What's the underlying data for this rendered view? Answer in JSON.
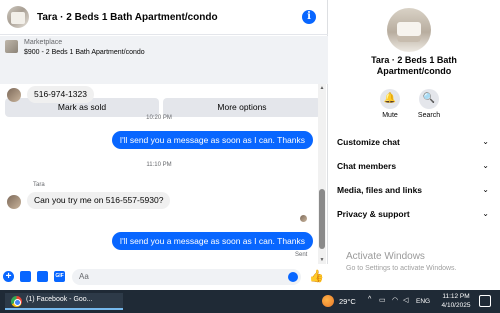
{
  "header": {
    "title": "Tara · 2 Beds 1 Bath Apartment/condo"
  },
  "listing": {
    "label": "Marketplace",
    "title": "$900 - 2 Beds 1 Bath Apartment/condo",
    "buttons": [
      "Mark as sold",
      "More options"
    ]
  },
  "messages": {
    "phone_bubble": "516-974-1323",
    "time_1": "10:20 PM",
    "out_1": "I'll send you a message as soon as I can. Thanks",
    "time_2": "11:10 PM",
    "sender": "Tara",
    "in_1": "Can you try me on 516-557-5930?",
    "out_2": "I'll send you a message as soon as I can. Thanks",
    "status": "Sent"
  },
  "composer": {
    "placeholder": "Aa"
  },
  "side": {
    "title": "Tara · 2 Beds 1 Bath Apartment/condo",
    "actions": [
      "Mute",
      "Search"
    ],
    "sections": [
      "Customize chat",
      "Chat members",
      "Media, files and links",
      "Privacy & support"
    ]
  },
  "watermark": {
    "title": "Activate Windows",
    "sub": "Go to Settings to activate Windows."
  },
  "taskbar": {
    "app_label": "(1) Facebook - Goo...",
    "temperature": "29°C",
    "language": "ENG",
    "time": "11:12 PM",
    "date": "4/10/2025"
  },
  "colors": {
    "accent": "#0866ff",
    "bubble_in": "#f0f0f0",
    "taskbar": "#1f2a36"
  }
}
